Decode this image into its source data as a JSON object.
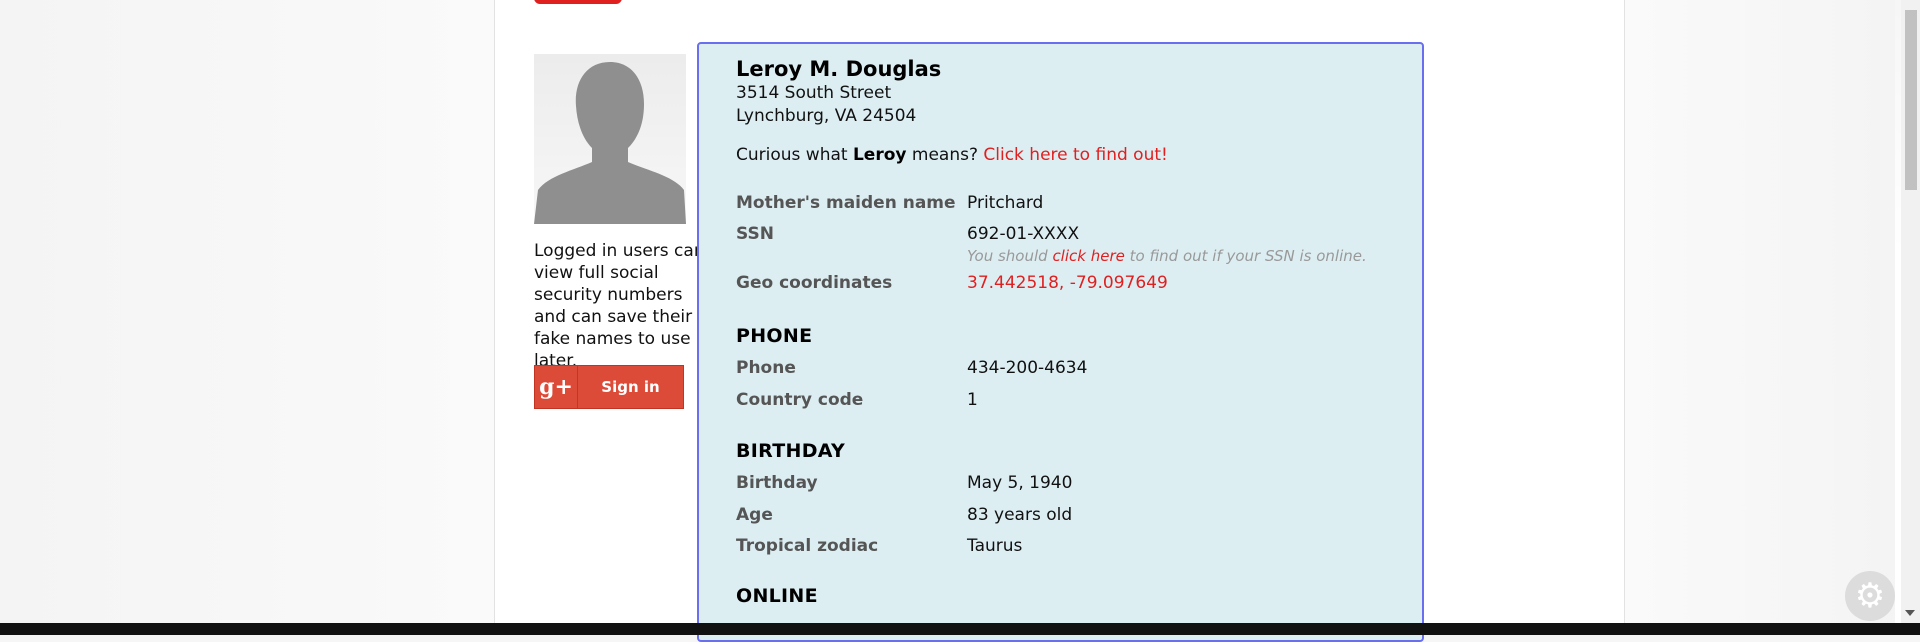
{
  "identity": {
    "full_name": "Leroy M. Douglas",
    "street": "3514 South Street",
    "city_state_zip": "Lynchburg, VA 24504"
  },
  "name_meaning": {
    "prefix": "Curious what ",
    "first_name": "Leroy",
    "middle": " means? ",
    "link_text": "Click here to find out!"
  },
  "details": {
    "maiden_label": "Mother's maiden name",
    "maiden_value": "Pritchard",
    "ssn_label": "SSN",
    "ssn_value": "692-01-XXXX",
    "ssn_hint_prefix": "You should ",
    "ssn_hint_link": "click here",
    "ssn_hint_suffix": " to find out if your SSN is online.",
    "geo_label": "Geo coordinates",
    "geo_value": "37.442518, -79.097649"
  },
  "phone_section": {
    "heading": "PHONE",
    "phone_label": "Phone",
    "phone_value": "434-200-4634",
    "country_label": "Country code",
    "country_value": "1"
  },
  "birthday_section": {
    "heading": "BIRTHDAY",
    "birthday_label": "Birthday",
    "birthday_value": "May 5, 1940",
    "age_label": "Age",
    "age_value": "83 years old",
    "zodiac_label": "Tropical zodiac",
    "zodiac_value": "Taurus"
  },
  "online_section": {
    "heading": "ONLINE"
  },
  "sidebar": {
    "login_note": "Logged in users can view full social security numbers and can save their fake names to use later.",
    "gplus_icon": "g+",
    "signin_label": "Sign in"
  },
  "colors": {
    "accent_red": "#e01f1f",
    "card_bg": "#ddeef3",
    "card_border": "#6a6ff0",
    "google_red": "#dc4a38"
  },
  "icons": {
    "settings": "gear-icon",
    "avatar": "person-silhouette-icon"
  }
}
